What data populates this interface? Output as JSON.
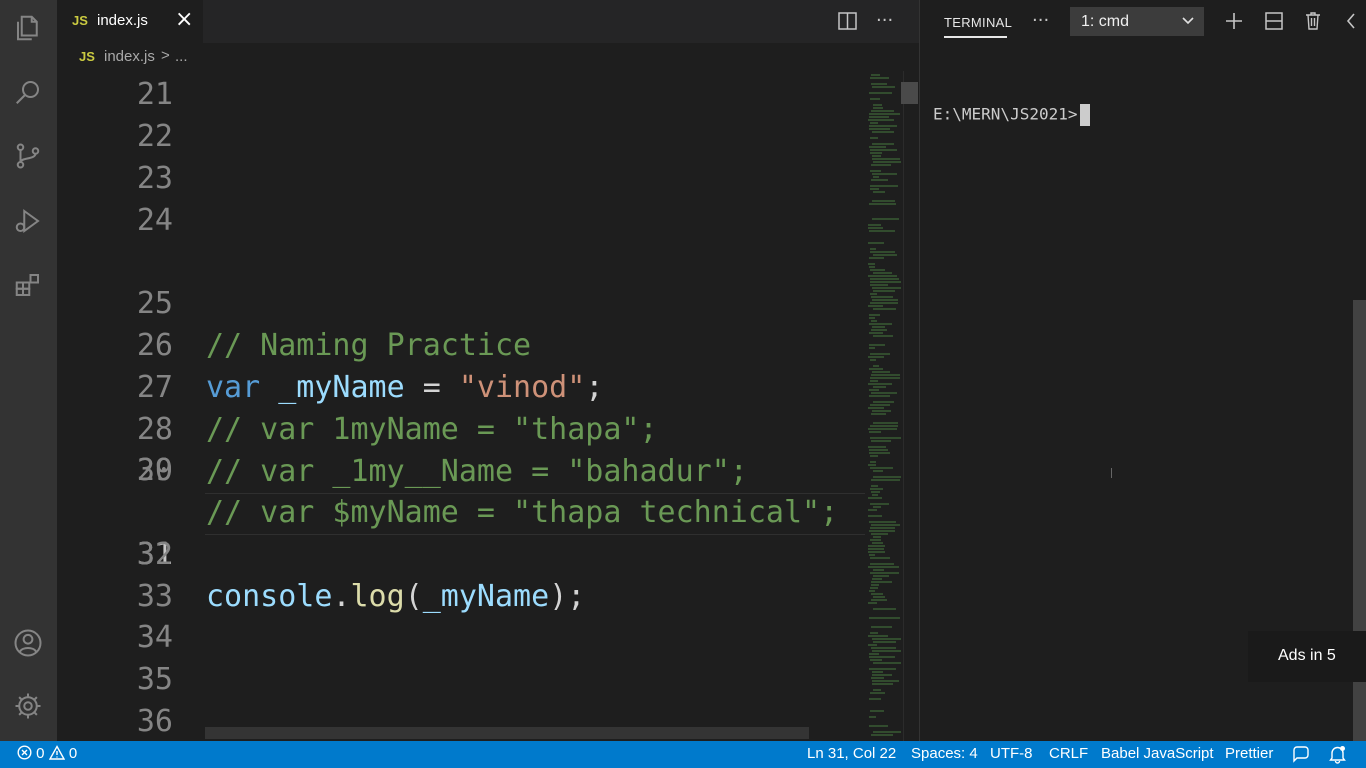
{
  "tab": {
    "badge": "JS",
    "label": "index.js",
    "close": "×"
  },
  "breadcrumb": {
    "badge": "JS",
    "file": "index.js",
    "sep": ">",
    "rest": "..."
  },
  "editor": {
    "lines": [
      {
        "num": "21"
      },
      {
        "num": "22"
      },
      {
        "num": "23"
      },
      {
        "num": "24"
      },
      {
        "num": "25",
        "t1": "// Naming Practice"
      },
      {
        "num": "26",
        "t1": "var",
        "t2": "_myName",
        "t3": " = ",
        "t4": "\"vinod\"",
        "t5": ";"
      },
      {
        "num": "27",
        "t1": "// var 1myName = \"thapa\";"
      },
      {
        "num": "28",
        "t1": "// var _1my__Name = \"bahadur\";"
      },
      {
        "num": "29",
        "t1": "// var $myName = \"thapa technical\";"
      },
      {
        "num": "30"
      },
      {
        "num": "31",
        "t1": "console",
        "t2": ".",
        "t3": "log",
        "t4": "(",
        "t5": "_myName",
        "t6": ");"
      },
      {
        "num": "32"
      },
      {
        "num": "33"
      },
      {
        "num": "34"
      },
      {
        "num": "35"
      },
      {
        "num": "36"
      }
    ]
  },
  "terminal": {
    "title": "TERMINAL",
    "more": "···",
    "select": "1: cmd",
    "prompt": "E:\\MERN\\JS2021>"
  },
  "ads": {
    "label": "Ads in 5"
  },
  "status": {
    "errors": "0",
    "warnings": "0",
    "position": "Ln 31, Col 22",
    "spaces": "Spaces: 4",
    "encoding": "UTF-8",
    "eol": "CRLF",
    "language": "Babel JavaScript",
    "formatter": "Prettier"
  },
  "colors": {
    "statusbar": "#007acc",
    "comment": "#6a9955",
    "keyword": "#569cd6",
    "string": "#ce9178"
  }
}
